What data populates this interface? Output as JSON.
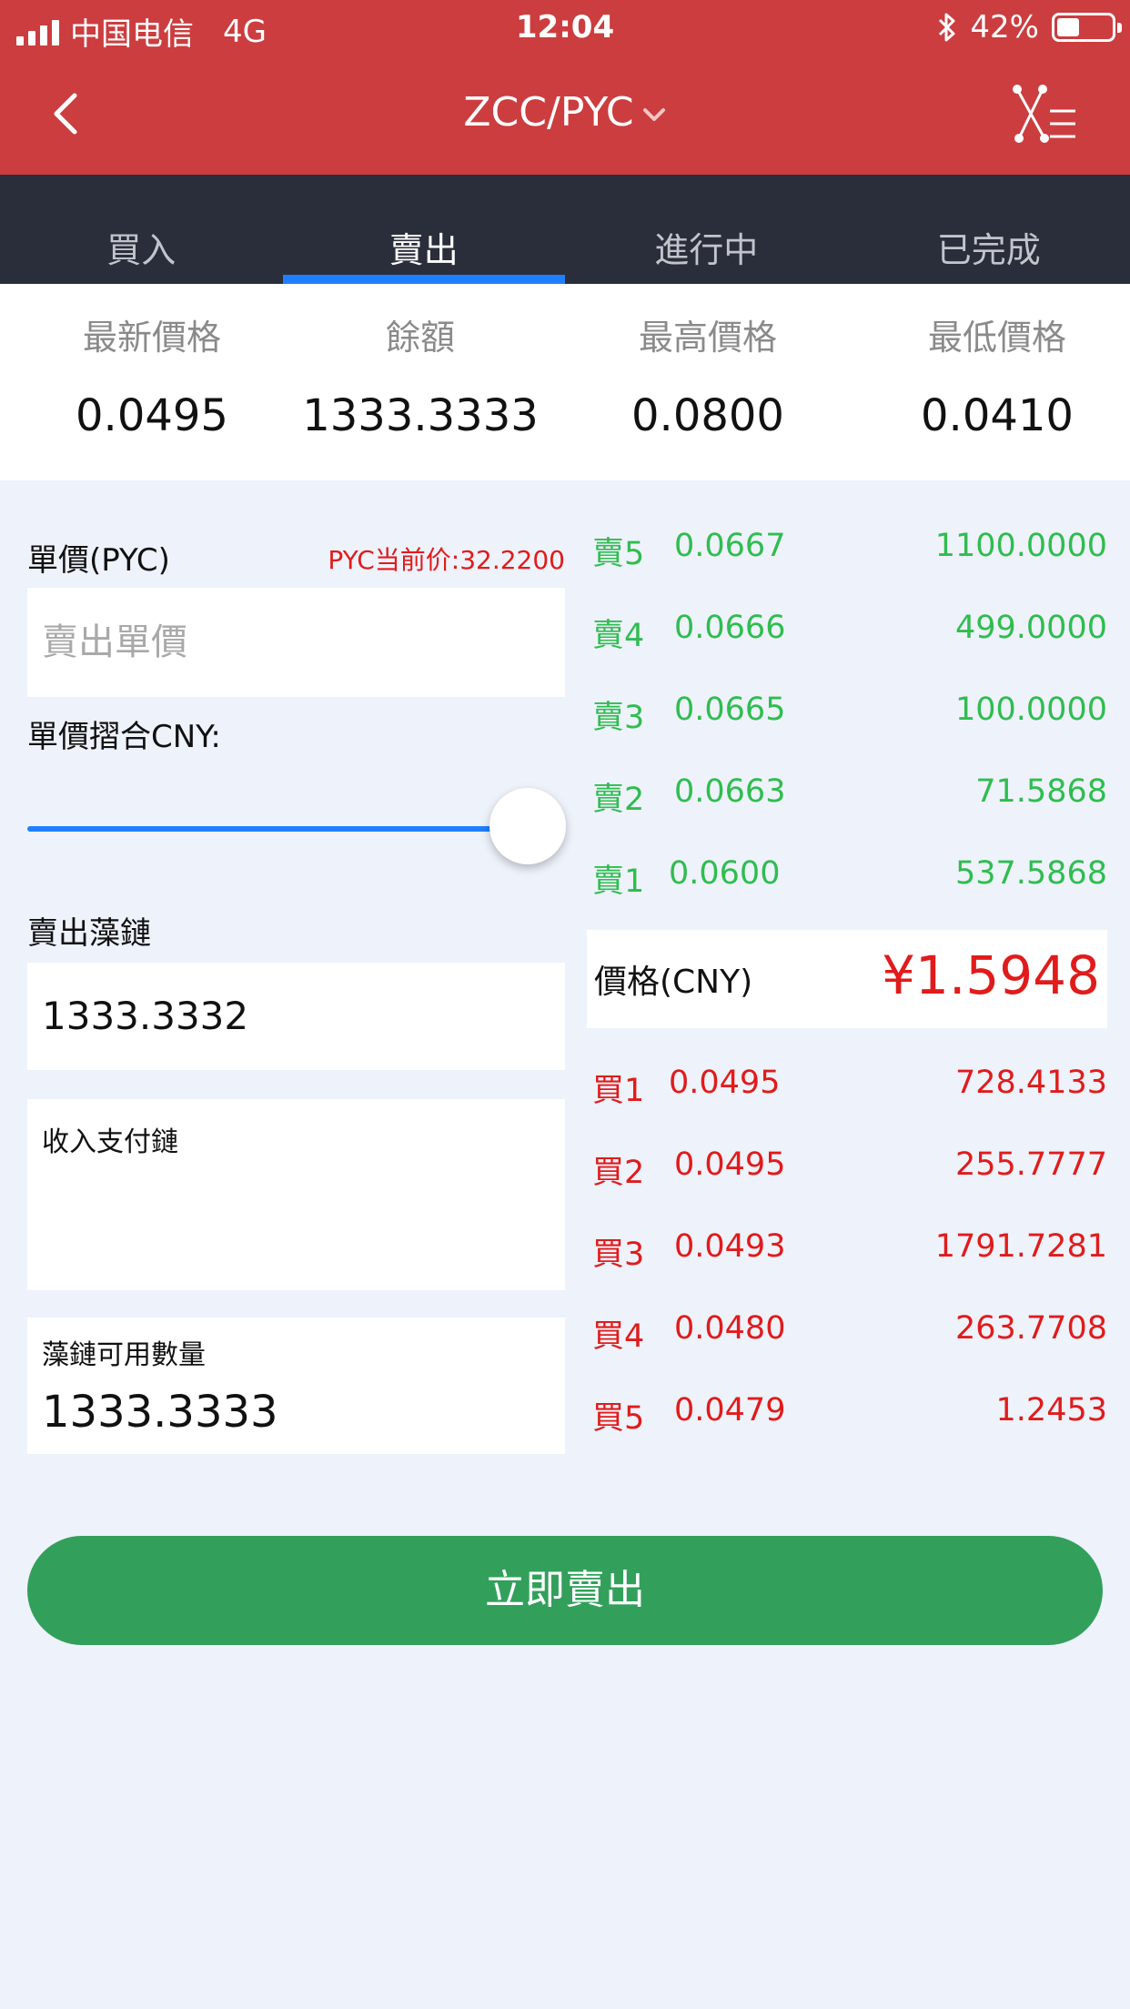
{
  "status_bar": {
    "carrier": "中国电信",
    "network": "4G",
    "time": "12:04",
    "battery": "42%",
    "battery_level": 0.42
  },
  "header": {
    "title": "ZCC/PYC",
    "colors": {
      "background": "#cc3d3f",
      "tabs_background": "#2a2d3a",
      "active_tab_indicator": "#1f7fff"
    }
  },
  "tabs": [
    {
      "label": "買入",
      "active": false
    },
    {
      "label": "賣出",
      "active": true
    },
    {
      "label": "進行中",
      "active": false
    },
    {
      "label": "已完成",
      "active": false
    }
  ],
  "stats": [
    {
      "label": "最新價格",
      "value": "0.0495"
    },
    {
      "label": "餘額",
      "value": "1333.3333"
    },
    {
      "label": "最高價格",
      "value": "0.0800"
    },
    {
      "label": "最低價格",
      "value": "0.0410"
    }
  ],
  "form": {
    "unit_price_label": "單價(PYC)",
    "pyc_current_price": "PYC当前价:32.2200",
    "unit_price_placeholder": "賣出單價",
    "cny_equiv_label": "單價摺合CNY:",
    "slider_level": 1.0,
    "sell_amount_label": "賣出藻鏈",
    "sell_amount_value": "1333.3332",
    "income_chain_placeholder": "收入支付鏈",
    "available_label": "藻鏈可用數量",
    "available_value": "1333.3333"
  },
  "order_book": {
    "sells": [
      {
        "level": "賣5",
        "price": "0.0667",
        "qty": "1100.0000"
      },
      {
        "level": "賣4",
        "price": "0.0666",
        "qty": "499.0000"
      },
      {
        "level": "賣3",
        "price": "0.0665",
        "qty": "100.0000"
      },
      {
        "level": "賣2",
        "price": "0.0663",
        "qty": "71.5868"
      },
      {
        "level": "賣1",
        "price": "0.0600",
        "qty": "537.5868"
      }
    ],
    "cny_label": "價格(CNY)",
    "cny_value": "¥1.5948",
    "buys": [
      {
        "level": "買1",
        "price": "0.0495",
        "qty": "728.4133"
      },
      {
        "level": "買2",
        "price": "0.0495",
        "qty": "255.7777"
      },
      {
        "level": "買3",
        "price": "0.0493",
        "qty": "1791.7281"
      },
      {
        "level": "買4",
        "price": "0.0480",
        "qty": "263.7708"
      },
      {
        "level": "買5",
        "price": "0.0479",
        "qty": "1.2453"
      }
    ],
    "colors": {
      "sell": "#2fbd4f",
      "buy": "#e11b1b"
    }
  },
  "actions": {
    "sell_now_label": "立即賣出",
    "sell_now_color": "#32a05b"
  }
}
